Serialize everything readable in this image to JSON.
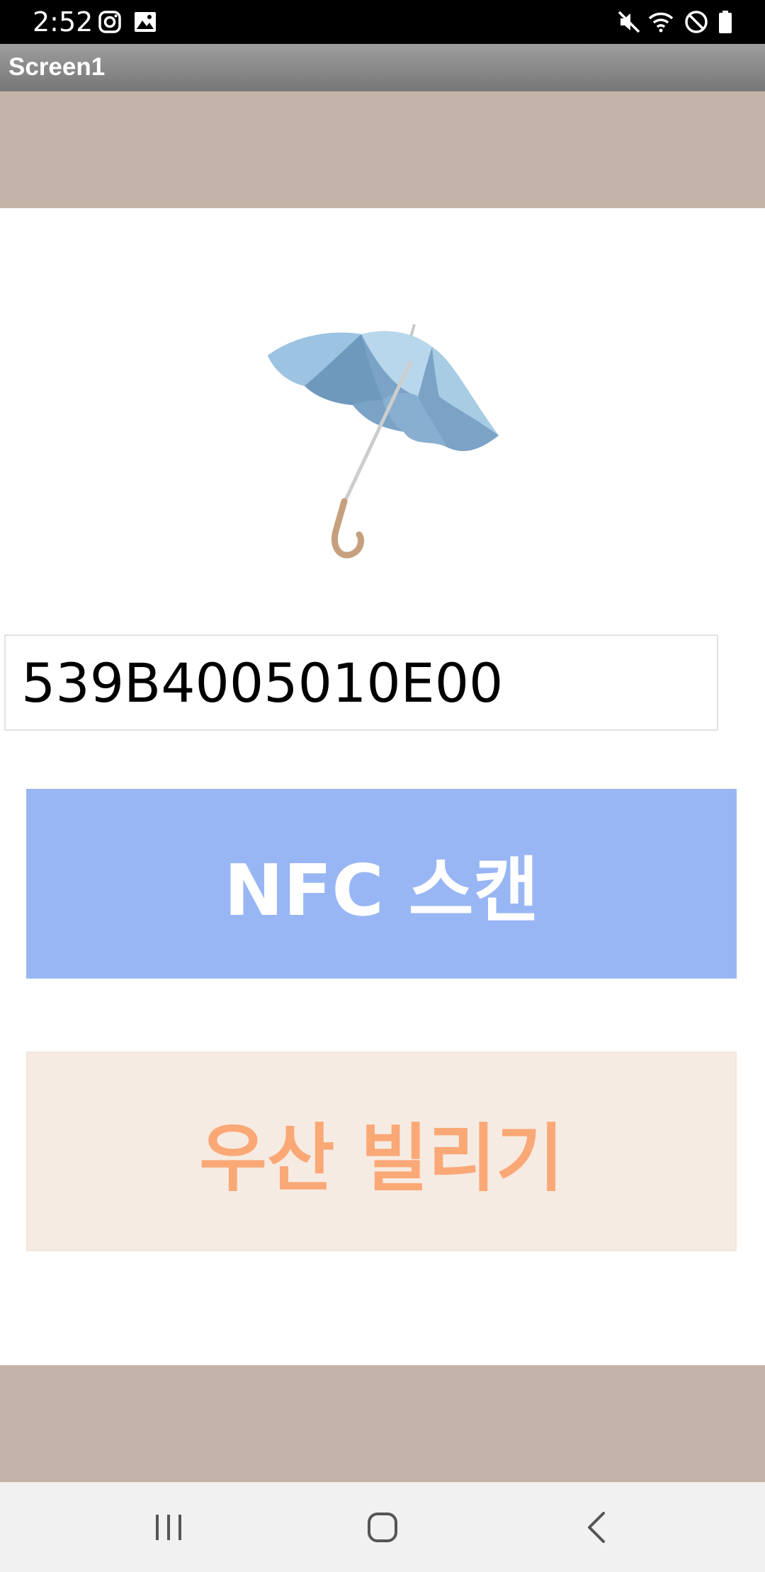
{
  "status_bar": {
    "time": "2:52",
    "left_icons": [
      "instagram-icon",
      "image-icon"
    ],
    "right_icons": [
      "mute-icon",
      "wifi-icon",
      "do-not-disturb-icon",
      "battery-icon"
    ]
  },
  "title_bar": {
    "title": "Screen1"
  },
  "main": {
    "image": "umbrella-image",
    "nfc_field_value": "539B4005010E00",
    "scan_button_label": "NFC 스캔",
    "rent_button_label": "우산 빌리기"
  },
  "nav_bar": {
    "buttons": [
      "recent-apps-icon",
      "home-icon",
      "back-icon"
    ]
  },
  "colors": {
    "band": "#c4b3a8",
    "scan_button": "#99b6f4",
    "rent_button_bg": "#f6ebe2",
    "rent_button_text": "#fba877"
  }
}
